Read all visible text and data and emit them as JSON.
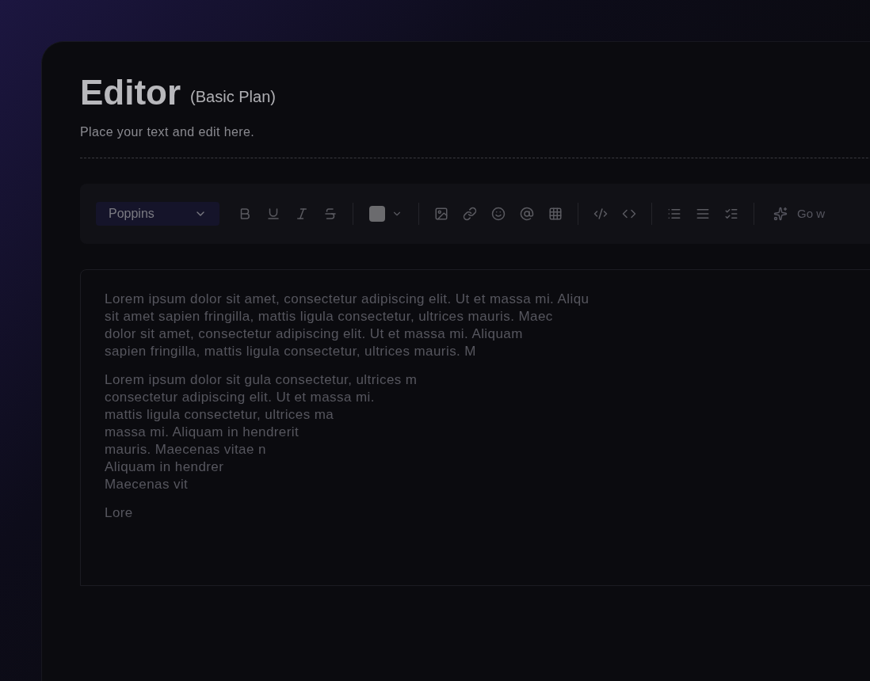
{
  "header": {
    "title": "Editor",
    "plan": "(Basic Plan)",
    "subtitle": "Place your text and edit here."
  },
  "toolbar": {
    "font": "Poppins",
    "ai_button": "Go w"
  },
  "editor": {
    "paragraphs": [
      [
        "Lorem ipsum dolor sit amet, consectetur adipiscing elit. Ut et massa mi. Aliqu",
        "sit amet sapien fringilla, mattis ligula consectetur, ultrices mauris. Maec",
        "dolor sit amet, consectetur adipiscing elit. Ut et massa mi. Aliquam",
        "sapien fringilla, mattis ligula consectetur, ultrices mauris. M"
      ],
      [
        "Lorem ipsum dolor sit gula consectetur, ultrices m",
        "consectetur adipiscing elit. Ut et massa mi.",
        "mattis ligula consectetur, ultrices ma",
        "massa mi. Aliquam in hendrerit",
        "mauris. Maecenas vitae n",
        "Aliquam in hendrer",
        "Maecenas vit"
      ],
      [
        "Lore"
      ]
    ]
  }
}
